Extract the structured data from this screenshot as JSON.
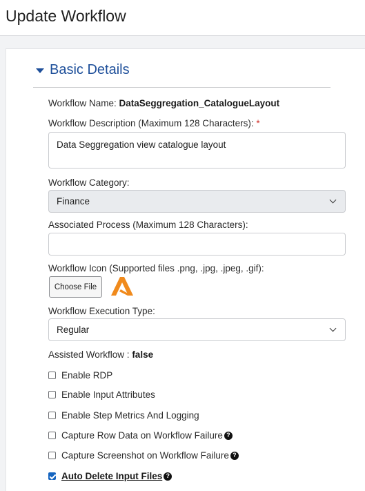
{
  "header": {
    "title": "Update Workflow"
  },
  "section": {
    "title": "Basic Details"
  },
  "workflow_name": {
    "label": "Workflow Name:",
    "value": "DataSeggregation_CatalogueLayout"
  },
  "description": {
    "label": "Workflow Description (Maximum 128 Characters):",
    "required_mark": "*",
    "value": "Data Seggregation view catalogue layout"
  },
  "category": {
    "label": "Workflow Category:",
    "selected": "Finance"
  },
  "associated_process": {
    "label": "Associated Process (Maximum 128 Characters):",
    "value": ""
  },
  "icon": {
    "label": "Workflow Icon (Supported files .png, .jpg, .jpeg, .gif):",
    "button_label": "Choose File",
    "logo_color": "#f08a1c"
  },
  "execution_type": {
    "label": "Workflow Execution Type:",
    "selected": "Regular"
  },
  "assisted": {
    "label": "Assisted Workflow :",
    "value": "false"
  },
  "options": [
    {
      "label": "Enable RDP",
      "checked": false,
      "help": false
    },
    {
      "label": "Enable Input Attributes",
      "checked": false,
      "help": false
    },
    {
      "label": "Enable Step Metrics And Logging",
      "checked": false,
      "help": false
    },
    {
      "label": "Capture Row Data on Workflow Failure",
      "checked": false,
      "help": true
    },
    {
      "label": "Capture Screenshot on Workflow Failure",
      "checked": false,
      "help": true
    },
    {
      "label": "Auto Delete Input Files",
      "checked": true,
      "help": true
    }
  ],
  "help_glyph": "?",
  "accent_color": "#1e4f9a"
}
